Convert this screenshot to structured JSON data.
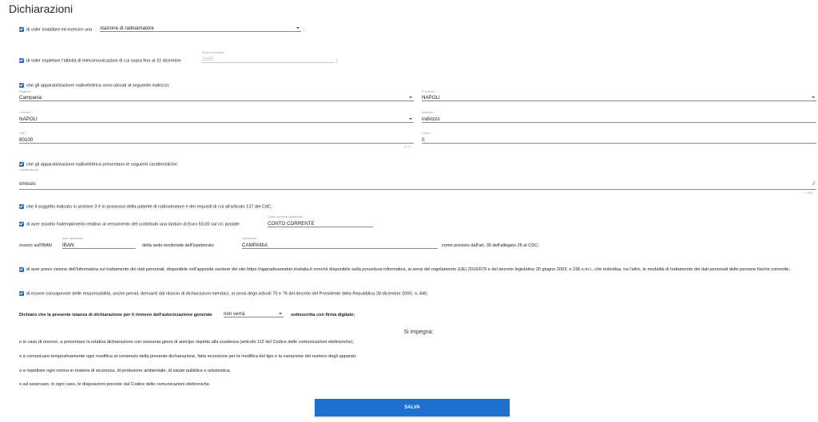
{
  "page": {
    "title": "Dichiarazioni"
  },
  "decl_install": {
    "text": "di voler installare ed esercire una",
    "select_value": "stazione di radioamatore",
    "suffix": ";"
  },
  "decl_year": {
    "text": "di voler espletare l'attività di telecomunicazioni di cui sopra fino al 31 dicembre",
    "field_label": "Anno conclusivo",
    "field_value": "2035",
    "suffix": ";"
  },
  "decl_address": {
    "text": "che gli apparati/stazione radioelettrica sono ubicati al seguente indirizzo:",
    "regione": {
      "label": "Regione *",
      "value": "Campania"
    },
    "provincia": {
      "label": "Provincia *",
      "value": "NAPOLI"
    },
    "comune": {
      "label": "Comune *",
      "value": "NAPOLI"
    },
    "indirizzo": {
      "label": "Indirizzo *",
      "value": "indirizzo"
    },
    "cap": {
      "label": "CAP *",
      "value": "80100",
      "counter": "5 / 5"
    },
    "civico": {
      "label": "Civico *",
      "value": "0"
    }
  },
  "decl_features": {
    "text": "che gli apparati/stazione radioelettrica presentano le seguenti caratteristiche:",
    "field_label": "Caratteristiche",
    "field_value": "omissis",
    "counter": "7 / 500"
  },
  "decl_patent": {
    "text": "che il soggetto indicato in sezione 3 è in possesso della patente di radioamatore e dei requisiti di cui all'articolo 137 del CdC;"
  },
  "decl_payment": {
    "text": "di aver assolto l'adempimento relativo al versamento del contributo una tantum di Euro 50,00 sul c/c postale",
    "postal_label": "Conto corrente Ispettorato",
    "postal_value": "CONTO CORRENTE",
    "iban_prefix": "ovvero sull'IBAN",
    "iban_label": "Iban Ispettorato",
    "iban_value": "IBAN",
    "sede_text": "della sede territoriale dell'Ispettorato",
    "sede_label": "Ispettorato",
    "sede_value": "CAMPANIA",
    "tail": "come previsto dall'art. 35 dell'allegato 25 al CDC;"
  },
  "decl_privacy": {
    "text": "di aver preso visione dell'informativa sul trattamento dei dati personali, disponibile nell'apposita sezione del sito https://appradioamatori.invitalia.it nonché disponibile sulla procedura informatica, ai sensi del regolamento (UE) 2016/679 e del decreto legislativo 30 giugno 2003, n.196 s.m.i., che individua, tra l'altro, le modalità di trattamento dei dati personali delle persone fisiche coinvolte;"
  },
  "decl_responsibility": {
    "text": "di essere consapevole delle responsabilità, anche penali, derivanti dal rilascio di dichiarazioni mendaci, ai sensi degli articoli 75 e 76 del decreto del Presidente della Repubblica 28 dicembre 2000, n. 445;"
  },
  "declare": {
    "prefix": "Dichiaro che la presente istanza di dichiarazione per il rinnovo dell'autorizzazione generale",
    "select_value": "non verrà",
    "suffix": "sottoscritta con firma digitale;"
  },
  "commitments": {
    "heading": "Si impegna:",
    "items": [
      "o in caso di rinnovo, a presentare la relativa dichiarazione con sessanta giorni di anticipo rispetto alla scadenza (articolo 112 del Codice delle comunicazioni elettroniche);",
      "o a comunicare tempestivamente ogni modifica al contenuto della presente dichiarazione, fatta eccezione per la modifica del tipo e la variazione del numero degli apparati;",
      "o a rispettare ogni norma in materia di sicurezza, di protezione ambientale, di salute pubblica e urbanistica;",
      "o ad osservare, in ogni caso, le disposizioni previste dal Codice delle comunicazioni elettroniche."
    ]
  },
  "actions": {
    "save_label": "SALVA"
  },
  "colors": {
    "accent": "#1f6fd1",
    "checkbox": "#2a66c7"
  }
}
